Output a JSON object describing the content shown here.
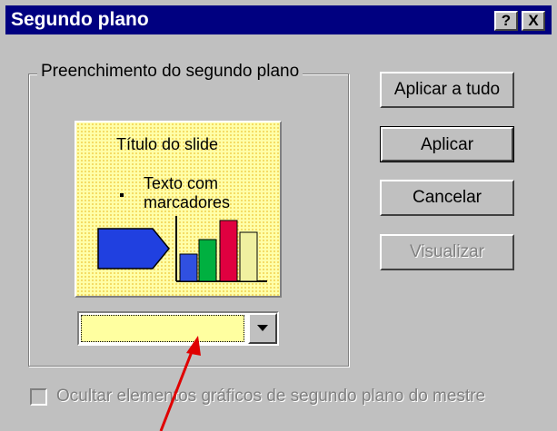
{
  "window": {
    "title": "Segundo plano",
    "help_label": "?",
    "close_label": "X"
  },
  "fill_group": {
    "label": "Preenchimento do segundo plano",
    "preview": {
      "title": "Título do slide",
      "bullet_text": "Texto com marcadores"
    },
    "combo_color": "#ffffa0"
  },
  "buttons": {
    "apply_all": "Aplicar a tudo",
    "apply": "Aplicar",
    "cancel": "Cancelar",
    "preview": "Visualizar"
  },
  "hide_master_graphics": {
    "label": "Ocultar elementos gráficos de segundo plano do mestre",
    "checked": false,
    "enabled": false
  },
  "colors": {
    "titlebar": "#000080",
    "dialog": "#c0c0c0",
    "preview_bg": "#ffffa8",
    "annotation_arrow": "#e00000"
  }
}
